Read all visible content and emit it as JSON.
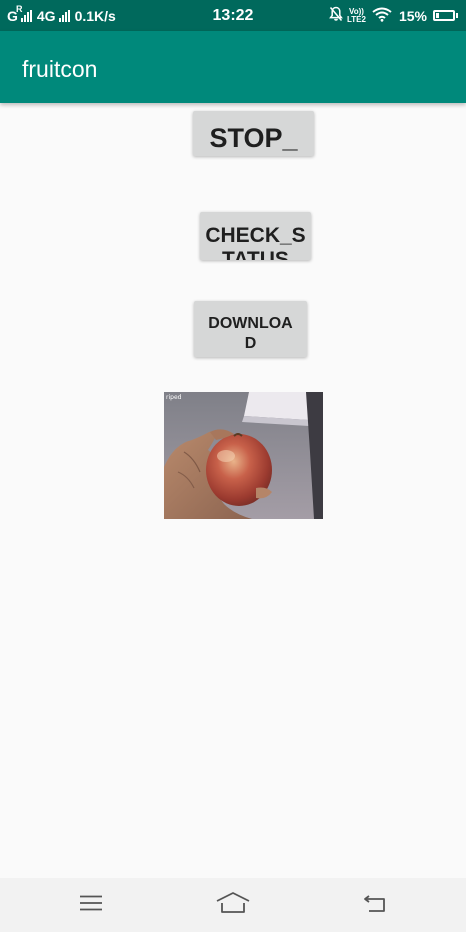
{
  "status_bar": {
    "network_g": "G",
    "network_r": "R",
    "network_4g": "4G",
    "speed": "0.1K/s",
    "time": "13:22",
    "volte_top": "Vo))",
    "volte_bottom": "LTE2",
    "battery_percent": "15%",
    "battery_level": 0.15
  },
  "app_bar": {
    "title": "fruitcon"
  },
  "buttons": {
    "stop_label": "STOP_",
    "check_status_label": "CHECK_STATUS",
    "download_label": "DOWNLOAD"
  },
  "photo": {
    "overlay_label": "riped",
    "subject": "apple held in hand"
  },
  "nav_bar": {
    "menu_icon": "menu-icon",
    "home_icon": "home-icon",
    "back_icon": "back-icon"
  },
  "colors": {
    "status_bar": "#00695c",
    "app_bar": "#00897b",
    "button": "#d6d7d7",
    "background": "#fafafa"
  }
}
